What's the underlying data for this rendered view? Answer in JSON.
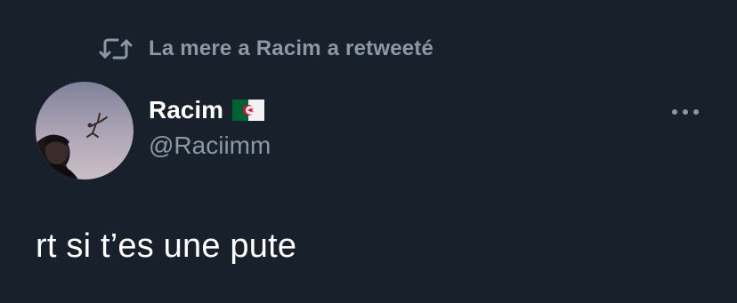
{
  "retweet": {
    "icon": "retweet-icon",
    "text": "La mere a Racim a retweeté"
  },
  "author": {
    "display_name": "Racim",
    "flag_icon": "algeria-flag-icon",
    "handle": "@Raciimm",
    "avatar_icon": "avatar-photo"
  },
  "menu": {
    "icon": "more-options-icon"
  },
  "tweet": {
    "text": "rt si t’es une pute"
  },
  "colors": {
    "background": "#17202b",
    "primary_text": "#ffffff",
    "secondary_text": "#8b98a5"
  }
}
